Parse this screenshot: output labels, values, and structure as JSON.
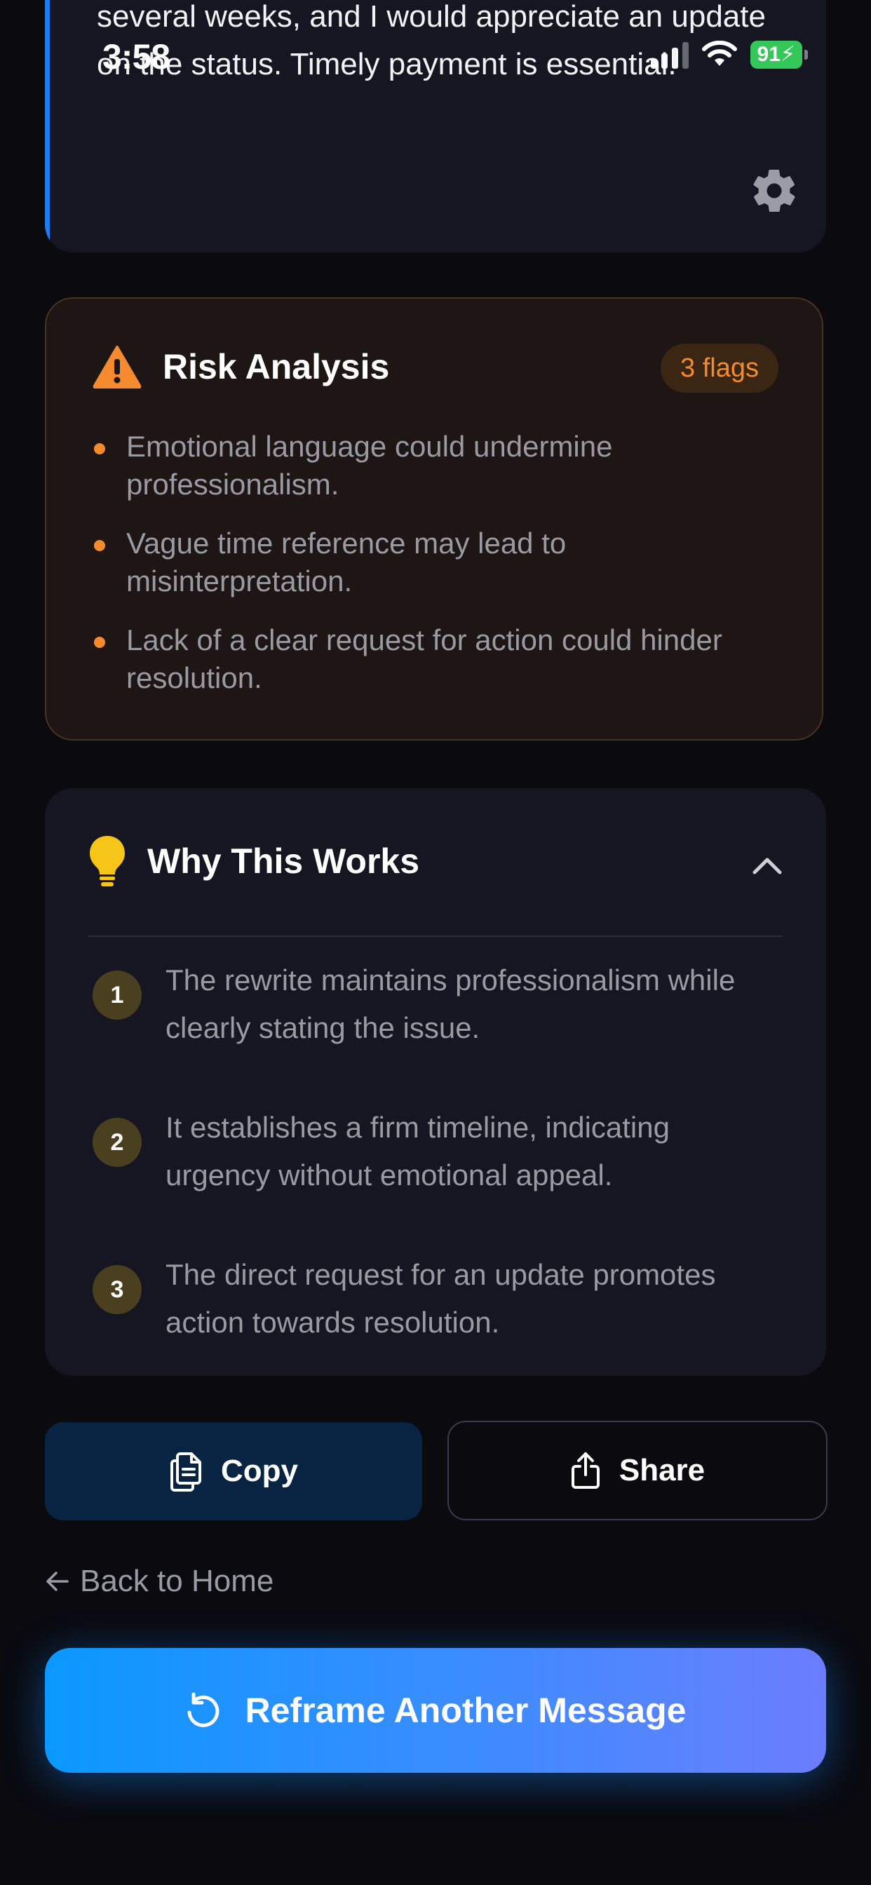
{
  "status_bar": {
    "time": "3:58",
    "battery": "91"
  },
  "message": {
    "text": "several weeks, and I would appreciate an update on the status. Timely payment is essential."
  },
  "risk_analysis": {
    "title": "Risk Analysis",
    "badge": "3 flags",
    "items": [
      "Emotional language could undermine professionalism.",
      "Vague time reference may lead to misinterpretation.",
      "Lack of a clear request for action could hinder resolution."
    ],
    "accent_color": "#f58a2e"
  },
  "why_this_works": {
    "title": "Why This Works",
    "items": [
      {
        "number": "1",
        "text": "The rewrite maintains professionalism while clearly stating the issue."
      },
      {
        "number": "2",
        "text": "It establishes a firm timeline, indicating urgency without emotional appeal."
      },
      {
        "number": "3",
        "text": "The direct request for an update promotes action towards resolution."
      }
    ]
  },
  "actions": {
    "copy_label": "Copy",
    "share_label": "Share",
    "back_label": "Back to Home",
    "reframe_label": "Reframe Another Message"
  },
  "icons": {
    "settings": "gear-icon",
    "warning": "warning-icon",
    "lightbulb": "lightbulb-icon",
    "chevron": "chevron-up-icon",
    "copy": "copy-icon",
    "share": "share-icon",
    "back": "arrow-left-icon",
    "reframe": "refresh-icon"
  },
  "colors": {
    "primary_gradient_start": "#0a98ff",
    "primary_gradient_end": "#6b7dff",
    "message_accent": "#1f7cf0"
  }
}
